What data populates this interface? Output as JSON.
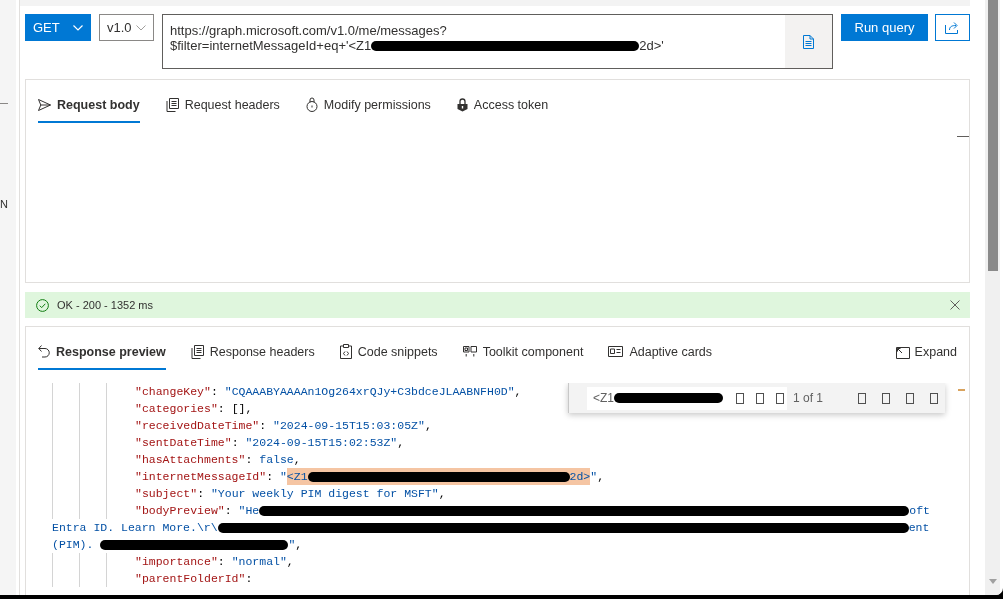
{
  "sidebar": {
    "text": "N"
  },
  "request_bar": {
    "method": "GET",
    "version": "v1.0",
    "url_lines": [
      [
        {
          "kind": "text",
          "text": "https://graph.microsoft.com/v1.0/me/messages?"
        }
      ],
      [
        {
          "kind": "text",
          "text": "$filter=internetMessageId+eq+'<Z1"
        },
        {
          "kind": "redaction"
        },
        {
          "kind": "text",
          "text": "2d>'"
        }
      ]
    ],
    "run_label": "Run query"
  },
  "request_tabs": [
    {
      "label": "Request body",
      "selected": true
    },
    {
      "label": "Request headers",
      "selected": false
    },
    {
      "label": "Modify permissions",
      "selected": false
    },
    {
      "label": "Access token",
      "selected": false
    }
  ],
  "status_bar": {
    "kind": "success",
    "text": "OK - 200 - 1352 ms"
  },
  "response_tabs": [
    {
      "label": "Response preview",
      "selected": true
    },
    {
      "label": "Response headers",
      "selected": false
    },
    {
      "label": "Code snippets",
      "selected": false
    },
    {
      "label": "Toolkit component",
      "selected": false
    },
    {
      "label": "Adaptive cards",
      "selected": false
    }
  ],
  "expand_label": "Expand",
  "response_lines": [
    {
      "kind": "property",
      "segments": [
        {
          "kind": "key",
          "text": "\"changeKey\""
        },
        {
          "kind": "punct",
          "text": ": "
        },
        {
          "kind": "string",
          "text": "\"CQAAABYAAAAn1Og264xrQJy+C3bdceJLAABNFH0D\""
        },
        {
          "kind": "punct",
          "text": ","
        }
      ]
    },
    {
      "kind": "property",
      "segments": [
        {
          "kind": "key",
          "text": "\"categories\""
        },
        {
          "kind": "punct",
          "text": ": [],"
        }
      ]
    },
    {
      "kind": "property",
      "segments": [
        {
          "kind": "key",
          "text": "\"receivedDateTime\""
        },
        {
          "kind": "punct",
          "text": ": "
        },
        {
          "kind": "string",
          "text": "\"2024-09-15T15:03:05Z\""
        },
        {
          "kind": "punct",
          "text": ","
        }
      ]
    },
    {
      "kind": "property",
      "segments": [
        {
          "kind": "key",
          "text": "\"sentDateTime\""
        },
        {
          "kind": "punct",
          "text": ": "
        },
        {
          "kind": "string",
          "text": "\"2024-09-15T15:02:53Z\""
        },
        {
          "kind": "punct",
          "text": ","
        }
      ]
    },
    {
      "kind": "property",
      "segments": [
        {
          "kind": "key",
          "text": "\"hasAttachments\""
        },
        {
          "kind": "punct",
          "text": ": "
        },
        {
          "kind": "literal",
          "text": "false"
        },
        {
          "kind": "punct",
          "text": ","
        }
      ]
    },
    {
      "kind": "property",
      "segments": [
        {
          "kind": "key",
          "text": "\"internetMessageId\""
        },
        {
          "kind": "punct",
          "text": ": "
        },
        {
          "kind": "string",
          "text": "\""
        },
        {
          "kind": "match",
          "segments": [
            {
              "kind": "string",
              "text": "<Z1"
            },
            {
              "kind": "redaction"
            },
            {
              "kind": "string",
              "text": "2d>"
            }
          ]
        },
        {
          "kind": "string",
          "text": "\""
        },
        {
          "kind": "punct",
          "text": ","
        }
      ]
    },
    {
      "kind": "property",
      "segments": [
        {
          "kind": "key",
          "text": "\"subject\""
        },
        {
          "kind": "punct",
          "text": ": "
        },
        {
          "kind": "string",
          "text": "\"Your weekly PIM digest for MSFT\""
        },
        {
          "kind": "punct",
          "text": ","
        }
      ]
    },
    {
      "kind": "property",
      "segments": [
        {
          "kind": "key",
          "text": "\"bodyPreview\""
        },
        {
          "kind": "punct",
          "text": ": "
        },
        {
          "kind": "string",
          "text": "\"He"
        },
        {
          "kind": "redaction"
        },
        {
          "kind": "string",
          "text": "oft"
        }
      ]
    },
    {
      "kind": "continuation",
      "segments": [
        {
          "kind": "string",
          "text": "Entra ID. Learn More.\\r\\"
        },
        {
          "kind": "redaction"
        },
        {
          "kind": "string",
          "text": "ent"
        }
      ]
    },
    {
      "kind": "continuation",
      "segments": [
        {
          "kind": "string",
          "text": "(PIM)."
        },
        {
          "kind": "redaction"
        },
        {
          "kind": "string",
          "text": "\""
        },
        {
          "kind": "punct",
          "text": ","
        }
      ]
    },
    {
      "kind": "property",
      "segments": [
        {
          "kind": "key",
          "text": "\"importance\""
        },
        {
          "kind": "punct",
          "text": ": "
        },
        {
          "kind": "string",
          "text": "\"normal\""
        },
        {
          "kind": "punct",
          "text": ","
        }
      ]
    },
    {
      "kind": "property",
      "segments": [
        {
          "kind": "key",
          "text": "\"parentFolderId\""
        },
        {
          "kind": "punct",
          "text": ":"
        }
      ]
    }
  ],
  "find_widget": {
    "segments": [
      {
        "kind": "text",
        "text": "<Z1"
      },
      {
        "kind": "redaction"
      }
    ],
    "count": "1 of 1"
  }
}
